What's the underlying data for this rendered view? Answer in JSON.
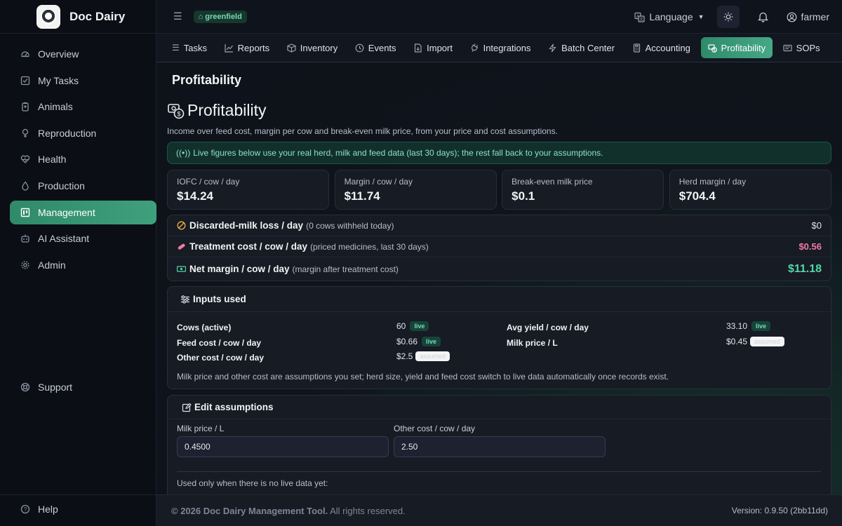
{
  "app": {
    "name": "Doc Dairy",
    "tenant": "greenfield"
  },
  "sidebar": {
    "items": [
      {
        "label": "Overview",
        "icon": "dashboard-icon"
      },
      {
        "label": "My Tasks",
        "icon": "checkbox-icon"
      },
      {
        "label": "Animals",
        "icon": "animals-icon"
      },
      {
        "label": "Reproduction",
        "icon": "reproduction-icon"
      },
      {
        "label": "Health",
        "icon": "heart-icon"
      },
      {
        "label": "Production",
        "icon": "droplet-icon"
      },
      {
        "label": "Management",
        "icon": "management-icon",
        "active": true
      },
      {
        "label": "AI Assistant",
        "icon": "robot-icon"
      },
      {
        "label": "Admin",
        "icon": "gear-icon"
      }
    ],
    "support": "Support",
    "help": "Help"
  },
  "topbar": {
    "language": "Language",
    "user": "farmer"
  },
  "tabs": [
    {
      "label": "Tasks",
      "icon": "list-icon"
    },
    {
      "label": "Reports",
      "icon": "chart-icon"
    },
    {
      "label": "Inventory",
      "icon": "box-icon"
    },
    {
      "label": "Events",
      "icon": "clock-icon"
    },
    {
      "label": "Import",
      "icon": "file-import-icon"
    },
    {
      "label": "Integrations",
      "icon": "plug-icon"
    },
    {
      "label": "Batch Center",
      "icon": "bolt-icon"
    },
    {
      "label": "Accounting",
      "icon": "calculator-icon"
    },
    {
      "label": "Profitability",
      "icon": "money-icon",
      "active": true
    },
    {
      "label": "SOPs",
      "icon": "book-icon"
    }
  ],
  "page": {
    "header": "Profitability",
    "title": "Profitability",
    "subtitle": "Income over feed cost, margin per cow and break-even milk price, from your price and cost assumptions.",
    "banner": "Live figures below use your real herd, milk and feed data (last 30 days); the rest fall back to your assumptions."
  },
  "cards": [
    {
      "label": "IOFC / cow / day",
      "value": "$14.24"
    },
    {
      "label": "Margin / cow / day",
      "value": "$11.74"
    },
    {
      "label": "Break-even milk price",
      "value": "$0.1"
    },
    {
      "label": "Herd margin / day",
      "value": "$704.4"
    }
  ],
  "losses": [
    {
      "label": "Discarded-milk loss / day",
      "note": "(0 cows withheld today)",
      "amount": "$0",
      "color": "#dfe3e8"
    },
    {
      "label": "Treatment cost / cow / day",
      "note": "(priced medicines, last 30 days)",
      "amount": "$0.56",
      "color": "#f07aa6"
    },
    {
      "label": "Net margin / cow / day",
      "note": "(margin after treatment cost)",
      "amount": "$11.18",
      "color": "#54d7a8"
    }
  ],
  "inputs": {
    "title": "Inputs used",
    "rows": [
      {
        "label": "Cows (active)",
        "value": "60",
        "badge": "live"
      },
      {
        "label": "Feed cost / cow / day",
        "value": "$0.66",
        "badge": "live"
      },
      {
        "label": "Other cost / cow / day",
        "value": "$2.5",
        "badge": "assumed"
      },
      {
        "label": "Avg yield / cow / day",
        "value": "33.10",
        "badge": "live"
      },
      {
        "label": "Milk price / L",
        "value": "$0.45",
        "badge": "assumed"
      }
    ],
    "note": "Milk price and other cost are assumptions you set; herd size, yield and feed cost switch to live data automatically once records exist."
  },
  "edit": {
    "title": "Edit assumptions",
    "milk_price_label": "Milk price / L",
    "milk_price_value": "0.4500",
    "other_cost_label": "Other cost / cow / day",
    "other_cost_value": "2.50",
    "note": "Used only when there is no live data yet:"
  },
  "footer": {
    "copyright": "© 2026 Doc Dairy Management Tool.",
    "rights": " All rights reserved.",
    "version": "Version: 0.9.50 (2bb11dd)"
  }
}
